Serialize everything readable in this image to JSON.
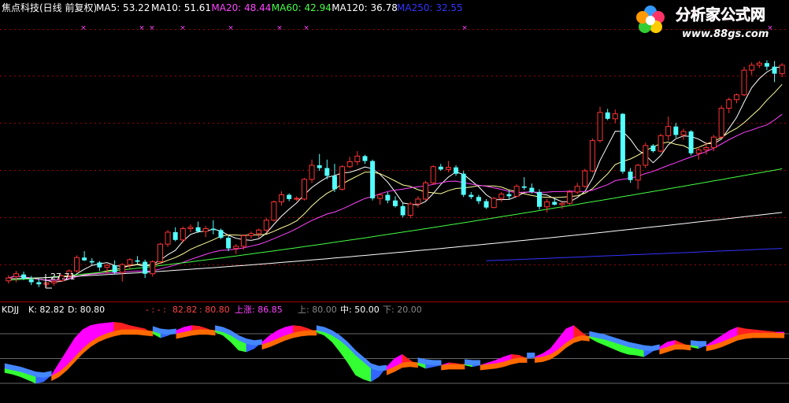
{
  "title_bar": {
    "stock_label": "焦点科技(日线 前复权)",
    "ma_items": [
      {
        "label": "MA5: 53.22",
        "color": "#ffffff"
      },
      {
        "label": "MA10: 51.61",
        "color": "#ffffff"
      },
      {
        "label": "MA20: 48.44",
        "color": "#ff44ff"
      },
      {
        "label": "MA60: 42.94",
        "color": "#44ff44"
      },
      {
        "label": "MA120: 36.78",
        "color": "#ffffff"
      },
      {
        "label": "MA250: 32.55",
        "color": "#3333ff"
      }
    ]
  },
  "logo": {
    "text": "分析家公式网",
    "url_text": "www.88gs.com"
  },
  "colors": {
    "up": "#ff3333",
    "down": "#54ffff",
    "grid": "#a00000",
    "ma5": "#ffffff",
    "ma10": "#ffff99",
    "ma20": "#ff44ff",
    "ma60": "#44ff44",
    "ma120": "#ffffff",
    "ma250": "#3333ff"
  },
  "min_price_label": "27.71",
  "kdj_header": {
    "name": "KDJJ",
    "k_label": "K: 82.82",
    "d_label": "D: 80.80",
    "sep_label": "- : - :",
    "k_val": "82.82",
    "d_val": ": 80.80",
    "up_label": "上涨: 86.85",
    "upper_label": "上: 80.00",
    "mid_label": "中: 50.00",
    "lower_label": "下: 20.00"
  },
  "chart_data": [
    {
      "type": "candlestick",
      "title": "焦点科技(日线 前复权)",
      "ylim": [
        26,
        66
      ],
      "candles": [
        [
          28.6,
          29.4,
          28.2,
          29.0
        ],
        [
          29.2,
          30.0,
          28.4,
          29.6
        ],
        [
          29.5,
          29.9,
          28.7,
          28.9
        ],
        [
          28.8,
          29.3,
          28.0,
          28.4
        ],
        [
          28.4,
          28.9,
          27.7,
          28.1
        ],
        [
          28.1,
          28.4,
          27.7,
          28.3
        ],
        [
          28.3,
          28.7,
          27.9,
          28.5
        ],
        [
          28.6,
          29.5,
          28.5,
          29.3
        ],
        [
          29.3,
          30.2,
          28.9,
          30.0
        ],
        [
          30.0,
          32.2,
          29.8,
          31.9
        ],
        [
          31.9,
          32.8,
          31.4,
          31.5
        ],
        [
          31.4,
          31.8,
          30.8,
          31.2
        ],
        [
          31.2,
          31.4,
          30.0,
          30.5
        ],
        [
          30.5,
          31.0,
          29.6,
          30.8
        ],
        [
          30.8,
          31.5,
          29.5,
          29.8
        ],
        [
          29.8,
          31.1,
          28.5,
          30.9
        ],
        [
          30.9,
          31.8,
          30.3,
          31.6
        ],
        [
          31.5,
          32.1,
          31.0,
          31.3
        ],
        [
          31.3,
          31.6,
          29.0,
          29.6
        ],
        [
          29.6,
          31.5,
          29.2,
          31.3
        ],
        [
          31.3,
          34.0,
          31.0,
          33.8
        ],
        [
          33.8,
          35.8,
          33.4,
          35.5
        ],
        [
          35.5,
          36.2,
          34.2,
          34.4
        ],
        [
          34.4,
          36.3,
          34.0,
          36.0
        ],
        [
          36.0,
          36.6,
          35.5,
          36.2
        ],
        [
          36.2,
          37.0,
          35.4,
          35.6
        ],
        [
          35.6,
          36.4,
          34.8,
          36.0
        ],
        [
          36.0,
          37.2,
          35.2,
          35.8
        ],
        [
          35.8,
          36.0,
          34.5,
          34.7
        ],
        [
          34.7,
          35.0,
          32.8,
          33.2
        ],
        [
          33.2,
          33.8,
          32.4,
          33.5
        ],
        [
          33.5,
          35.2,
          33.0,
          35.0
        ],
        [
          35.0,
          35.6,
          34.6,
          35.3
        ],
        [
          35.3,
          36.0,
          34.7,
          35.8
        ],
        [
          35.8,
          37.5,
          35.4,
          37.2
        ],
        [
          37.2,
          40.0,
          37.0,
          39.8
        ],
        [
          39.8,
          41.3,
          39.3,
          40.8
        ],
        [
          40.8,
          41.0,
          39.9,
          40.2
        ],
        [
          40.2,
          40.6,
          39.9,
          40.3
        ],
        [
          40.2,
          43.2,
          40.0,
          43.0
        ],
        [
          43.0,
          45.8,
          42.5,
          45.0
        ],
        [
          45.0,
          46.6,
          44.2,
          44.6
        ],
        [
          44.6,
          45.8,
          43.0,
          43.5
        ],
        [
          43.5,
          45.2,
          41.2,
          41.6
        ],
        [
          41.6,
          45.0,
          41.4,
          44.8
        ],
        [
          44.8,
          46.2,
          44.6,
          45.5
        ],
        [
          45.5,
          47.0,
          45.0,
          46.3
        ],
        [
          46.3,
          46.5,
          45.2,
          45.6
        ],
        [
          45.6,
          45.8,
          40.0,
          40.3
        ],
        [
          40.3,
          41.0,
          39.4,
          40.8
        ],
        [
          40.8,
          41.2,
          39.6,
          40.0
        ],
        [
          40.0,
          40.6,
          39.0,
          39.2
        ],
        [
          39.2,
          39.6,
          37.6,
          37.9
        ],
        [
          37.9,
          39.8,
          37.5,
          39.5
        ],
        [
          39.5,
          40.6,
          39.0,
          40.2
        ],
        [
          40.2,
          42.8,
          40.0,
          42.5
        ],
        [
          42.5,
          45.0,
          42.2,
          44.8
        ],
        [
          44.8,
          45.2,
          44.2,
          44.4
        ],
        [
          44.4,
          45.6,
          44.0,
          44.7
        ],
        [
          44.7,
          45.0,
          43.5,
          43.8
        ],
        [
          43.8,
          44.2,
          40.5,
          40.8
        ],
        [
          40.8,
          41.2,
          40.2,
          40.5
        ],
        [
          40.5,
          40.8,
          39.5,
          39.9
        ],
        [
          39.9,
          40.2,
          38.8,
          39.0
        ],
        [
          39.0,
          40.5,
          38.9,
          40.3
        ],
        [
          40.3,
          41.2,
          39.8,
          40.9
        ],
        [
          40.9,
          41.4,
          40.2,
          40.6
        ],
        [
          40.6,
          42.3,
          40.5,
          42.0
        ],
        [
          42.0,
          43.3,
          41.5,
          41.8
        ],
        [
          41.8,
          42.4,
          41.0,
          41.2
        ],
        [
          41.2,
          41.6,
          38.7,
          39.1
        ],
        [
          39.1,
          40.2,
          38.3,
          39.8
        ],
        [
          39.8,
          40.2,
          39.3,
          39.4
        ],
        [
          39.4,
          39.8,
          38.8,
          39.6
        ],
        [
          39.6,
          41.5,
          39.4,
          41.2
        ],
        [
          41.2,
          42.5,
          40.9,
          42.0
        ],
        [
          42.0,
          44.5,
          41.8,
          44.2
        ],
        [
          44.2,
          48.8,
          44.0,
          48.5
        ],
        [
          48.5,
          53.3,
          48.2,
          52.5
        ],
        [
          52.5,
          53.0,
          51.4,
          51.6
        ],
        [
          51.6,
          52.9,
          51.0,
          52.3
        ],
        [
          52.3,
          52.4,
          43.8,
          44.1
        ],
        [
          44.1,
          44.6,
          42.5,
          42.9
        ],
        [
          42.9,
          45.2,
          41.6,
          45.0
        ],
        [
          45.0,
          48.2,
          44.6,
          47.8
        ],
        [
          47.8,
          48.0,
          46.8,
          47.0
        ],
        [
          47.0,
          49.5,
          46.8,
          49.2
        ],
        [
          49.2,
          51.9,
          48.5,
          50.5
        ],
        [
          50.5,
          51.0,
          48.9,
          49.3
        ],
        [
          49.3,
          50.2,
          48.6,
          49.8
        ],
        [
          49.8,
          50.0,
          46.4,
          46.7
        ],
        [
          46.7,
          47.6,
          45.8,
          47.2
        ],
        [
          47.2,
          48.3,
          46.5,
          47.5
        ],
        [
          47.5,
          49.3,
          47.0,
          49.0
        ],
        [
          49.0,
          53.5,
          48.8,
          53.1
        ],
        [
          53.1,
          54.6,
          52.4,
          54.3
        ],
        [
          54.3,
          55.2,
          53.8,
          55.0
        ],
        [
          55.0,
          59.0,
          54.8,
          58.5
        ],
        [
          58.5,
          59.6,
          57.8,
          59.2
        ],
        [
          59.2,
          59.8,
          58.8,
          59.5
        ],
        [
          59.5,
          59.9,
          58.5,
          59.0
        ],
        [
          59.0,
          59.8,
          56.8,
          58.0
        ],
        [
          58.0,
          59.5,
          57.5,
          59.2
        ]
      ],
      "ma_series": [
        "MA5",
        "MA10",
        "MA20",
        "MA60",
        "MA120",
        "MA250"
      ],
      "annotations": [
        {
          "text": "27.71",
          "at_index": 5
        }
      ]
    },
    {
      "type": "area",
      "title": "KDJJ",
      "ylim": [
        0,
        100
      ],
      "levels": {
        "upper": 80,
        "mid": 50,
        "lower": 20
      },
      "k": [
        33,
        31,
        28,
        24,
        20,
        22,
        30,
        45,
        60,
        75,
        85,
        90,
        92,
        93,
        94,
        93,
        90,
        88,
        86,
        80,
        75,
        78,
        84,
        88,
        90,
        89,
        86,
        82,
        78,
        70,
        60,
        58,
        62,
        70,
        78,
        84,
        88,
        90,
        89,
        86,
        82,
        78,
        70,
        58,
        45,
        30,
        25,
        22,
        28,
        40,
        50,
        55,
        48,
        42,
        38,
        40,
        42,
        45,
        44,
        42,
        40,
        42,
        45,
        48,
        52,
        55,
        54,
        50,
        52,
        56,
        62,
        74,
        86,
        90,
        82,
        75,
        70,
        66,
        62,
        58,
        55,
        54,
        52,
        58,
        64,
        70,
        72,
        68,
        64,
        62,
        66,
        72,
        78,
        84,
        88,
        86,
        85,
        84,
        83,
        82,
        82
      ],
      "d": [
        38,
        36,
        34,
        31,
        28,
        27,
        29,
        34,
        42,
        52,
        62,
        70,
        76,
        80,
        83,
        85,
        85,
        85,
        84,
        83,
        80,
        79,
        80,
        82,
        84,
        85,
        85,
        84,
        82,
        78,
        72,
        68,
        66,
        67,
        70,
        74,
        78,
        81,
        83,
        84,
        84,
        82,
        78,
        72,
        64,
        54,
        46,
        38,
        35,
        36,
        40,
        45,
        46,
        45,
        43,
        42,
        42,
        43,
        43,
        43,
        42,
        42,
        43,
        44,
        46,
        49,
        51,
        51,
        51,
        52,
        55,
        61,
        69,
        75,
        78,
        77,
        75,
        73,
        70,
        67,
        64,
        62,
        60,
        59,
        61,
        64,
        67,
        67,
        66,
        65,
        65,
        67,
        70,
        74,
        78,
        80,
        81,
        81,
        81,
        81,
        80.8
      ]
    }
  ]
}
